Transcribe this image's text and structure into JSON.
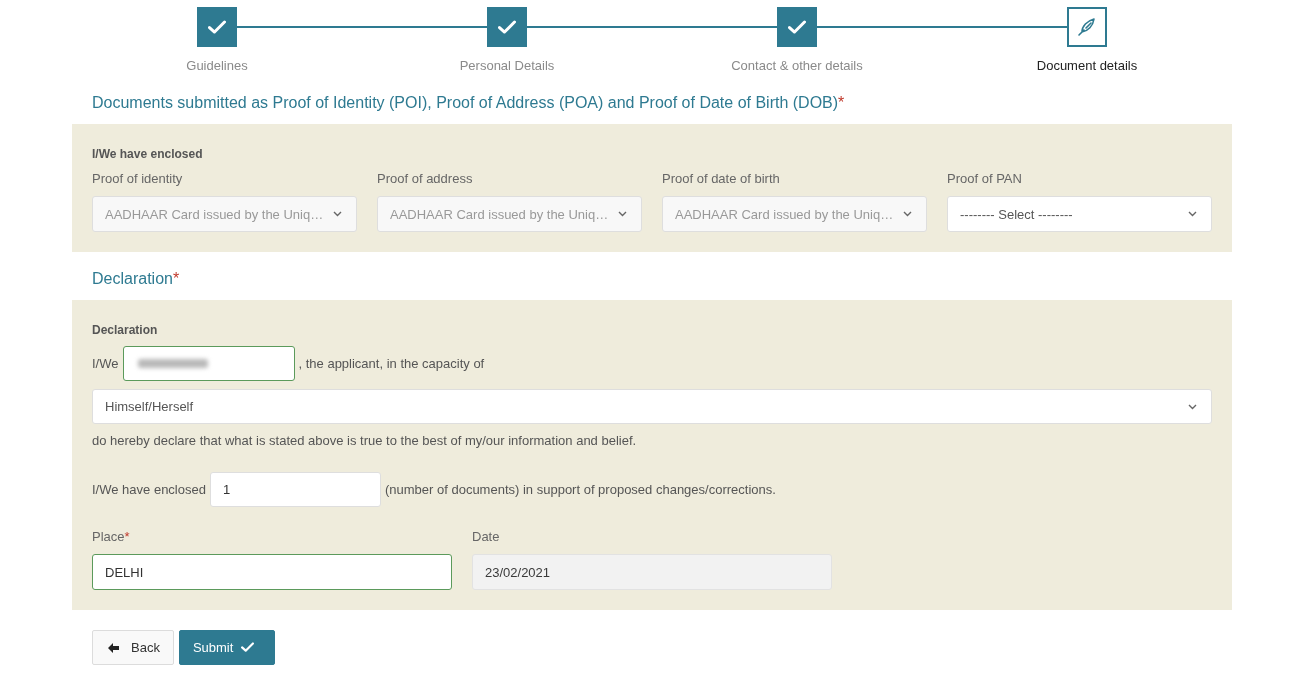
{
  "stepper": {
    "steps": [
      {
        "label": "Guidelines",
        "completed": true,
        "selected": false
      },
      {
        "label": "Personal Details",
        "completed": true,
        "selected": false
      },
      {
        "label": "Contact & other details",
        "completed": true,
        "selected": false
      },
      {
        "label": "Document details",
        "completed": false,
        "selected": true
      }
    ]
  },
  "documents_section": {
    "title": "Documents submitted as Proof of Identity (POI), Proof of Address (POA) and Proof of Date of Birth (DOB)",
    "required_mark": "*",
    "group_label": "I/We have enclosed",
    "fields": [
      {
        "label": "Proof of identity",
        "value": "AADHAAR Card issued by the Uniq…",
        "disabled": true
      },
      {
        "label": "Proof of address",
        "value": "AADHAAR Card issued by the Uniq…",
        "disabled": true
      },
      {
        "label": "Proof of date of birth",
        "value": "AADHAAR Card issued by the Uniq…",
        "disabled": true
      },
      {
        "label": "Proof of PAN",
        "value": "-------- Select --------",
        "disabled": false
      }
    ]
  },
  "declaration_section": {
    "title": "Declaration",
    "required_mark": "*",
    "group_label": "Declaration",
    "name_prefix": "I/We",
    "name_field": {
      "blurred": true,
      "valid": true
    },
    "name_suffix": ", the applicant, in the capacity of",
    "capacity": {
      "value": "Himself/Herself",
      "disabled": false
    },
    "statement": "do hereby declare that what is stated above is true to the best of my/our information and belief.",
    "enclosed_prefix": "I/We have enclosed",
    "enclosed_count": {
      "value": "1",
      "valid": false
    },
    "enclosed_suffix": "(number of documents) in support of proposed changes/corrections.",
    "place": {
      "label": "Place",
      "required_mark": "*",
      "value": "DELHI",
      "valid": true
    },
    "date": {
      "label": "Date",
      "value": "23/02/2021",
      "valid": false,
      "disabled": true
    }
  },
  "buttons": [
    {
      "kind": "back",
      "label": "Back"
    },
    {
      "kind": "submit",
      "label": "Submit"
    }
  ]
}
